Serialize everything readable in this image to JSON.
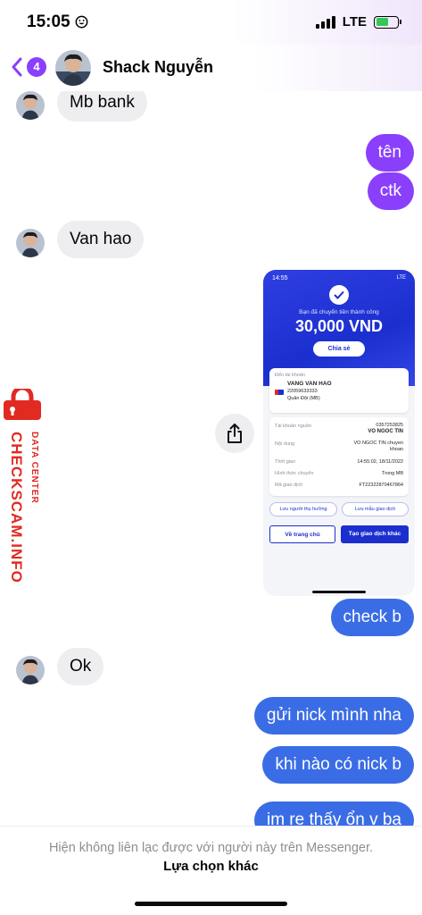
{
  "status_bar": {
    "time": "15:05",
    "network": "LTE",
    "battery_color": "#35c759"
  },
  "header": {
    "unread_badge": "4",
    "contact_name": "Shack Nguyễn"
  },
  "colors": {
    "accent_purple": "#8a3ffc",
    "accent_blue": "#3a6de5",
    "incoming_bg": "#eeeef0"
  },
  "messages": [
    {
      "direction": "in",
      "text": "Mb bank"
    },
    {
      "direction": "out",
      "text": "tên"
    },
    {
      "direction": "out",
      "text": "ctk"
    },
    {
      "direction": "in",
      "text": "Van hao"
    },
    {
      "direction": "out",
      "type": "image",
      "text": ""
    },
    {
      "direction": "out",
      "text": "check b"
    },
    {
      "direction": "in",
      "text": "Ok"
    },
    {
      "direction": "out",
      "text": "gửi nick mình nha"
    },
    {
      "direction": "out",
      "text": "khi nào có nick b"
    },
    {
      "direction": "out",
      "text": "im re thấy ổn v ba"
    }
  ],
  "receipt": {
    "time": "14:55",
    "network": "LTE",
    "success_text": "Bạn đã chuyển tiền thành công",
    "amount": "30,000 VND",
    "share_label": "Chia sẻ",
    "to_account_label": "Đến tài khoản",
    "recipient_name": "VANG VAN HAO",
    "recipient_account": "22059633333",
    "recipient_bank": "Quân Đội (MB)",
    "rows": [
      {
        "label": "Tài khoản nguồn",
        "value": "0357253825",
        "value2": "VO NGOC TIN"
      },
      {
        "label": "Nội dung",
        "value": "VO NGOC TIN chuyen",
        "value2": "khoan"
      },
      {
        "label": "Thời gian",
        "value": "14:55:02, 18/11/2022"
      },
      {
        "label": "Hình thức chuyển",
        "value": "Trong MB"
      },
      {
        "label": "Mã giao dịch",
        "value": "FT22322870467864"
      }
    ],
    "save_recipient": "Lưu người thụ hưởng",
    "save_template": "Lưu mẫu giao dịch",
    "home_button": "Về trang chủ",
    "new_transaction_button": "Tạo giao dịch khác"
  },
  "watermark": {
    "main": "CHECKSCAM.INFO",
    "sub": "DATA CENTER"
  },
  "footer": {
    "notice": "Hiện không liên lạc được với người này trên Messenger.",
    "other_options": "Lựa chọn khác"
  }
}
